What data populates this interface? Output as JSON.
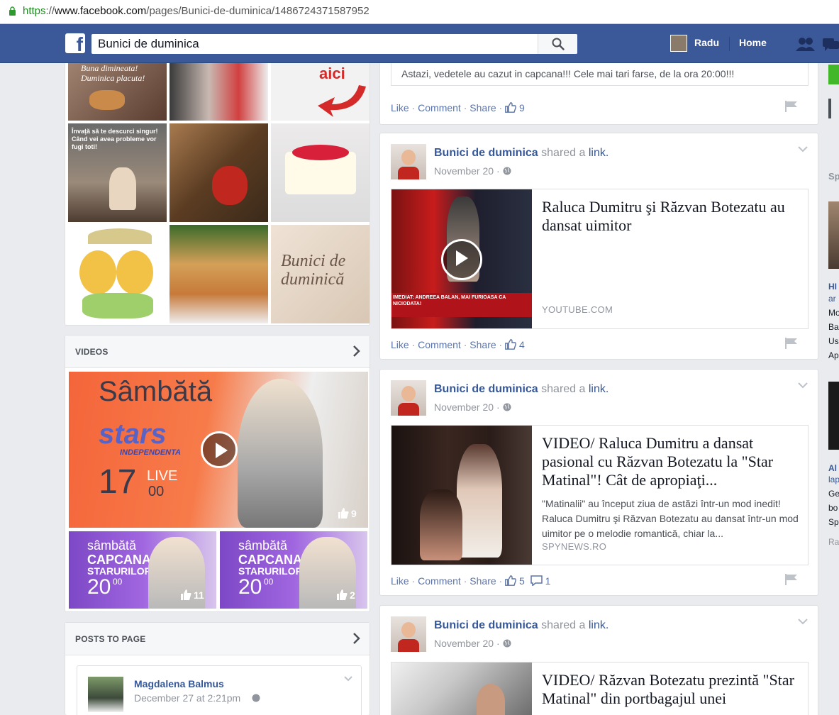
{
  "browser": {
    "url_scheme": "https",
    "url_sep": "://",
    "url_domain": "www.facebook.com",
    "url_path": "/pages/Bunici-de-duminica/1486724371587952"
  },
  "header": {
    "logo": "f",
    "search_value": "Bunici de duminica",
    "user_name": "Radu",
    "home_label": "Home"
  },
  "photos": {
    "tile1_text": "Buna dimineata! Duminica placuta!",
    "tile3_text": "aici",
    "tile4_text": "Învață să te descurci singur! Când vei avea probleme vor fugi toti!",
    "tile9_text": "Bunici de duminică"
  },
  "videos": {
    "title": "VIDEOS",
    "main_overlay": "Sâmbătă",
    "main_brand": "stars",
    "main_sub": "INDEPENDENTA",
    "main_time": "17",
    "main_time_small": "00",
    "main_live": "LIVE",
    "main_likes": "9",
    "thumb_text1": "sâmbătă",
    "thumb_text2": "CAPCANA",
    "thumb_text3": "STARURILOR",
    "thumb_time": "20",
    "thumb_time_small": "00",
    "thumb1_likes": "11",
    "thumb2_likes": "2"
  },
  "posts_to_page": {
    "title": "POSTS TO PAGE",
    "author": "Magdalena Balmus",
    "date": "December 27 at 2:21pm"
  },
  "feed": {
    "top_post_text": "Astazi, vedetele au cazut in capcana!!! Cele mai tari farse, de la ora 20:00!!!",
    "top_post_likes": "9",
    "like": "Like",
    "comment": "Comment",
    "share": "Share",
    "dot": "·",
    "page_name": "Bunici de duminica",
    "shared_a": "shared a",
    "link_word": "link.",
    "posts": [
      {
        "date": "November 20",
        "title": "Raluca Dumitru şi Răzvan Botezatu au dansat uimitor",
        "desc": "",
        "source": "YOUTUBE.COM",
        "likes": "4",
        "comments": "",
        "thumb_caption": "IMEDIAT: ANDREEA BALAN, MAI FURIOASA CA NICIODATA!"
      },
      {
        "date": "November 20",
        "title": "VIDEO/ Raluca Dumitru a dansat pasional cu Răzvan Botezatu la \"Star Matinal\"! Cât de apropiaţi...",
        "desc": "\"Matinalii\" au început ziua de astăzi într-un mod inedit! Raluca Dumitru şi Răzvan Botezatu au dansat într-un mod uimitor pe o melodie romantică, chiar la...",
        "source": "SPYNEWS.RO",
        "likes": "5",
        "comments": "1"
      },
      {
        "date": "November 20",
        "title": "VIDEO/ Răzvan Botezatu prezintă \"Star Matinal\" din portbagajul unei",
        "desc": "",
        "source": "",
        "likes": "",
        "comments": ""
      }
    ]
  },
  "right_col": {
    "frag1": "Sp",
    "frag2": "HI",
    "frag3": "ar",
    "frag4": "Mo",
    "frag5": "Ba",
    "frag6": "Us",
    "frag7": "Ap",
    "frag8": "Al",
    "frag9": "lap",
    "frag10": "Ge",
    "frag11": "bo",
    "frag12": "Sp",
    "frag13": "Ra"
  },
  "colors": {
    "fb_blue": "#3b5998",
    "link_blue": "#365899",
    "bg": "#e9ebee"
  }
}
